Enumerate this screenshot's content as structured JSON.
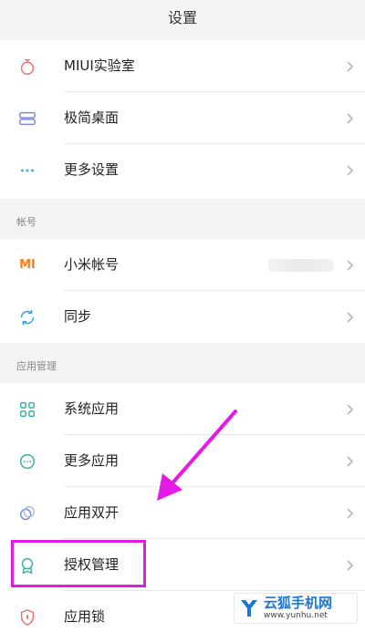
{
  "header": {
    "title": "设置"
  },
  "group1": {
    "items": [
      {
        "label": "MIUI实验室",
        "icon": "flask-icon"
      },
      {
        "label": "极简桌面",
        "icon": "desktop-icon"
      },
      {
        "label": "更多设置",
        "icon": "more-dots-icon"
      }
    ]
  },
  "account_section": {
    "title": "帐号",
    "items": [
      {
        "label": "小米帐号",
        "icon": "mi-logo-icon"
      },
      {
        "label": "同步",
        "icon": "sync-icon"
      }
    ]
  },
  "apps_section": {
    "title": "应用管理",
    "items": [
      {
        "label": "系统应用",
        "icon": "grid-icon"
      },
      {
        "label": "更多应用",
        "icon": "more-apps-icon"
      },
      {
        "label": "应用双开",
        "icon": "dual-apps-icon"
      },
      {
        "label": "授权管理",
        "icon": "permission-badge-icon"
      },
      {
        "label": "应用锁",
        "icon": "app-lock-icon"
      }
    ]
  },
  "account_icon_text": "MI",
  "watermark": {
    "title": "云狐手机网",
    "url": "www.yunhu.net"
  },
  "colors": {
    "accent_orange": "#ff7a1a",
    "highlight_magenta": "#e61ae6",
    "icon_teal": "#3ab0a0",
    "watermark_blue": "#1976d2"
  }
}
